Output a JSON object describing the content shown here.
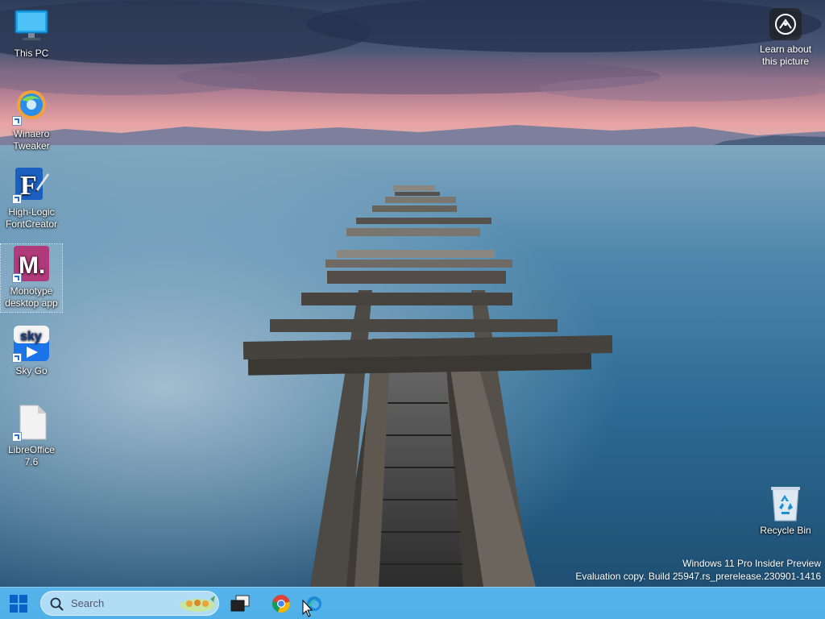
{
  "desktop": {
    "icons": [
      {
        "label": "This PC",
        "icon": "monitor-icon"
      },
      {
        "label": "Winaero\nTweaker",
        "icon": "winaero-tweaker-icon"
      },
      {
        "label": "High-Logic\nFontCreator",
        "icon": "fontcreator-icon"
      },
      {
        "label": "Monotype\ndesktop app",
        "icon": "monotype-icon"
      },
      {
        "label": "Sky Go",
        "icon": "sky-go-icon"
      },
      {
        "label": "LibreOffice\n7.6",
        "icon": "libreoffice-icon"
      }
    ],
    "recycle_bin": {
      "label": "Recycle Bin",
      "icon": "recycle-bin-icon"
    },
    "learn_about": {
      "label": "Learn about\nthis picture",
      "icon": "camera-aperture-icon"
    },
    "watermark": {
      "line1": "Windows 11 Pro Insider Preview",
      "line2": "Evaluation copy. Build 25947.rs_prerelease.230901-1416"
    }
  },
  "taskbar": {
    "start": {
      "icon": "windows-logo-icon"
    },
    "search": {
      "placeholder": "Search",
      "icon": "search-icon"
    },
    "items": [
      {
        "icon": "task-view-icon"
      },
      {
        "icon": "chrome-icon"
      },
      {
        "icon": "edge-icon"
      }
    ]
  },
  "colors": {
    "taskbar": "#4fb0e8",
    "water": "#2f6f98",
    "sky_pink": "#e7a1a6"
  }
}
